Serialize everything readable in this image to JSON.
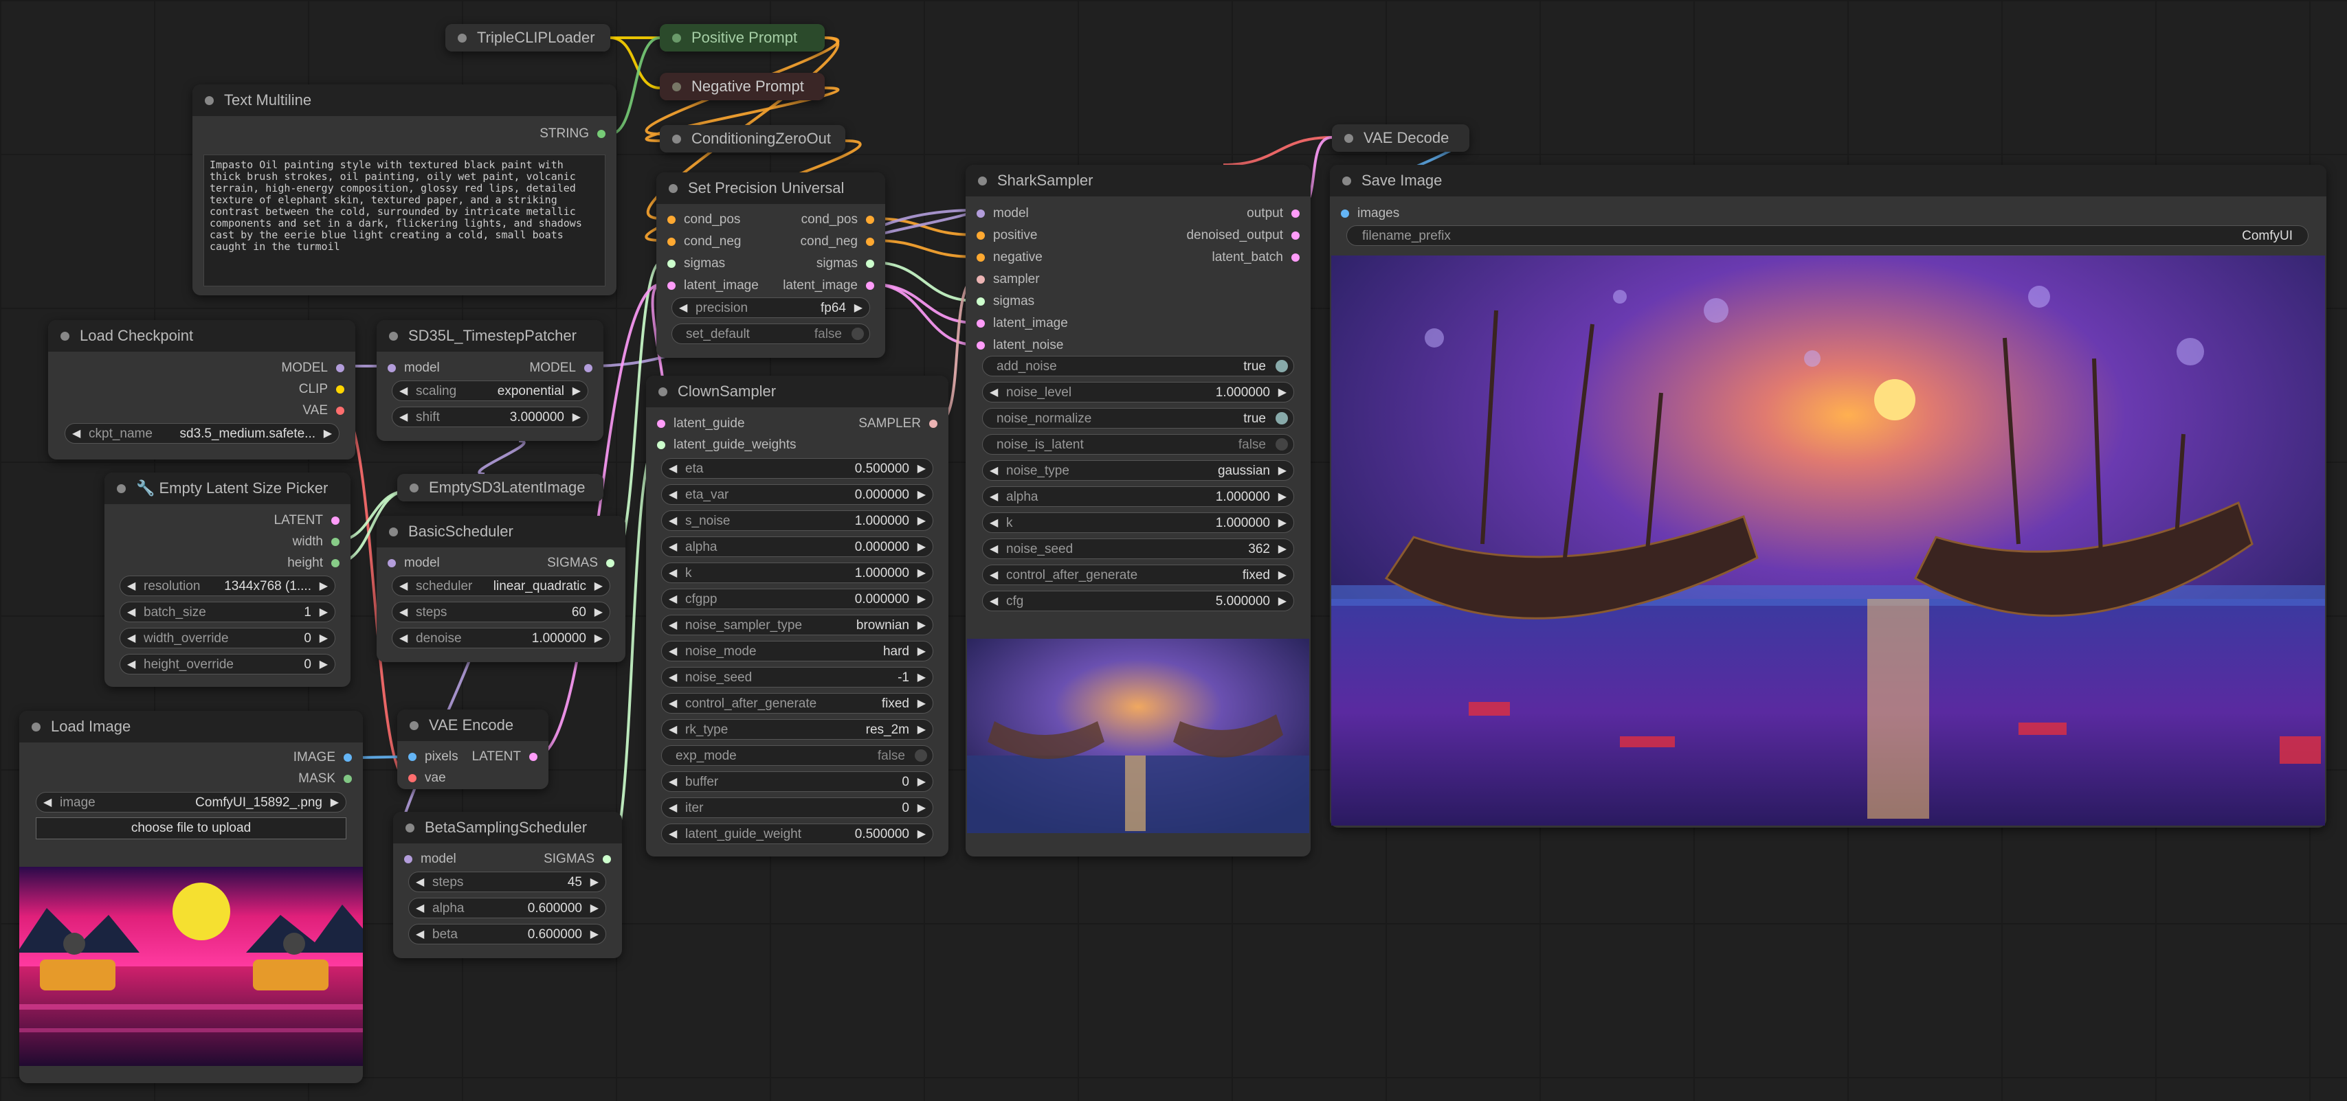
{
  "colors": {
    "canvas": "#202020",
    "model": "#b39ddb",
    "clip": "#ffd500",
    "vae": "#ff6e6e",
    "latent": "#ff9cf9",
    "conditioning": "#ffa931",
    "sigmas": "#cdffcd",
    "image": "#64b5f6",
    "mask": "#81c784",
    "sampler": "#ecb4b4",
    "string": "#77cc77"
  },
  "nodes": {
    "triple_clip": {
      "title": "TripleCLIPLoader"
    },
    "positive": {
      "title": "Positive Prompt"
    },
    "negative": {
      "title": "Negative Prompt"
    },
    "condzero": {
      "title": "ConditioningZeroOut"
    },
    "vae_decode": {
      "title": "VAE Decode"
    },
    "text_multiline": {
      "title": "Text Multiline",
      "out": "STRING",
      "text": "Impasto Oil painting style with textured black paint with thick brush strokes, oil painting, oily wet paint, volcanic terrain, high-energy composition, glossy red lips, detailed texture of elephant skin, textured paper, and a striking contrast between the cold, surrounded by intricate metallic components and set in a dark, flickering lights, and shadows cast by the eerie blue light creating a cold, small boats caught in the turmoil"
    },
    "set_precision": {
      "title": "Set Precision Universal",
      "inputs": [
        "cond_pos",
        "cond_neg",
        "sigmas",
        "latent_image"
      ],
      "outputs": [
        "cond_pos",
        "cond_neg",
        "sigmas",
        "latent_image"
      ],
      "precision_label": "precision",
      "precision_value": "fp64",
      "set_default_label": "set_default",
      "set_default_value": "false"
    },
    "load_checkpoint": {
      "title": "Load Checkpoint",
      "outputs": [
        "MODEL",
        "CLIP",
        "VAE"
      ],
      "ckpt_label": "ckpt_name",
      "ckpt_value": "sd3.5_medium.safete..."
    },
    "timestep_patcher": {
      "title": "SD35L_TimestepPatcher",
      "in": "model",
      "out": "MODEL",
      "scaling_label": "scaling",
      "scaling_value": "exponential",
      "shift_label": "shift",
      "shift_value": "3.000000"
    },
    "empty_latent_picker": {
      "title": "🔧 Empty Latent Size Picker",
      "outputs": [
        "LATENT",
        "width",
        "height"
      ],
      "widgets": [
        {
          "label": "resolution",
          "value": "1344x768 (1...."
        },
        {
          "label": "batch_size",
          "value": "1"
        },
        {
          "label": "width_override",
          "value": "0"
        },
        {
          "label": "height_override",
          "value": "0"
        }
      ]
    },
    "empty_sd3": {
      "title": "EmptySD3LatentImage"
    },
    "basic_scheduler": {
      "title": "BasicScheduler",
      "in": "model",
      "out": "SIGMAS",
      "widgets": [
        {
          "label": "scheduler",
          "value": "linear_quadratic"
        },
        {
          "label": "steps",
          "value": "60"
        },
        {
          "label": "denoise",
          "value": "1.000000"
        }
      ]
    },
    "load_image": {
      "title": "Load Image",
      "outputs": [
        "IMAGE",
        "MASK"
      ],
      "image_label": "image",
      "image_value": "ComfyUI_15892_.png",
      "upload_label": "choose file to upload"
    },
    "vae_encode": {
      "title": "VAE Encode",
      "inputs": [
        "pixels",
        "vae"
      ],
      "out": "LATENT"
    },
    "beta_scheduler": {
      "title": "BetaSamplingScheduler",
      "in": "model",
      "out": "SIGMAS",
      "widgets": [
        {
          "label": "steps",
          "value": "45"
        },
        {
          "label": "alpha",
          "value": "0.600000"
        },
        {
          "label": "beta",
          "value": "0.600000"
        }
      ]
    },
    "clown_sampler": {
      "title": "ClownSampler",
      "inputs": [
        "latent_guide",
        "latent_guide_weights"
      ],
      "out": "SAMPLER",
      "widgets": [
        {
          "label": "eta",
          "value": "0.500000"
        },
        {
          "label": "eta_var",
          "value": "0.000000"
        },
        {
          "label": "s_noise",
          "value": "1.000000"
        },
        {
          "label": "alpha",
          "value": "0.000000"
        },
        {
          "label": "k",
          "value": "1.000000"
        },
        {
          "label": "cfgpp",
          "value": "0.000000"
        },
        {
          "label": "noise_sampler_type",
          "value": "brownian"
        },
        {
          "label": "noise_mode",
          "value": "hard"
        },
        {
          "label": "noise_seed",
          "value": "-1"
        },
        {
          "label": "control_after_generate",
          "value": "fixed"
        },
        {
          "label": "rk_type",
          "value": "res_2m"
        },
        {
          "label": "exp_mode",
          "value": "false",
          "toggle": true
        },
        {
          "label": "buffer",
          "value": "0"
        },
        {
          "label": "iter",
          "value": "0"
        },
        {
          "label": "latent_guide_weight",
          "value": "0.500000"
        }
      ]
    },
    "shark_sampler": {
      "title": "SharkSampler",
      "inputs": [
        "model",
        "positive",
        "negative",
        "sampler",
        "sigmas",
        "latent_image",
        "latent_noise"
      ],
      "outputs": [
        "output",
        "denoised_output",
        "latent_batch"
      ],
      "widgets": [
        {
          "label": "add_noise",
          "value": "true",
          "toggle": true
        },
        {
          "label": "noise_level",
          "value": "1.000000"
        },
        {
          "label": "noise_normalize",
          "value": "true",
          "toggle": true
        },
        {
          "label": "noise_is_latent",
          "value": "false",
          "toggle": true
        },
        {
          "label": "noise_type",
          "value": "gaussian"
        },
        {
          "label": "alpha",
          "value": "1.000000"
        },
        {
          "label": "k",
          "value": "1.000000"
        },
        {
          "label": "noise_seed",
          "value": "362"
        },
        {
          "label": "control_after_generate",
          "value": "fixed"
        },
        {
          "label": "cfg",
          "value": "5.000000"
        }
      ]
    },
    "save_image": {
      "title": "Save Image",
      "in": "images",
      "prefix_label": "filename_prefix",
      "prefix_value": "ComfyUI"
    }
  }
}
